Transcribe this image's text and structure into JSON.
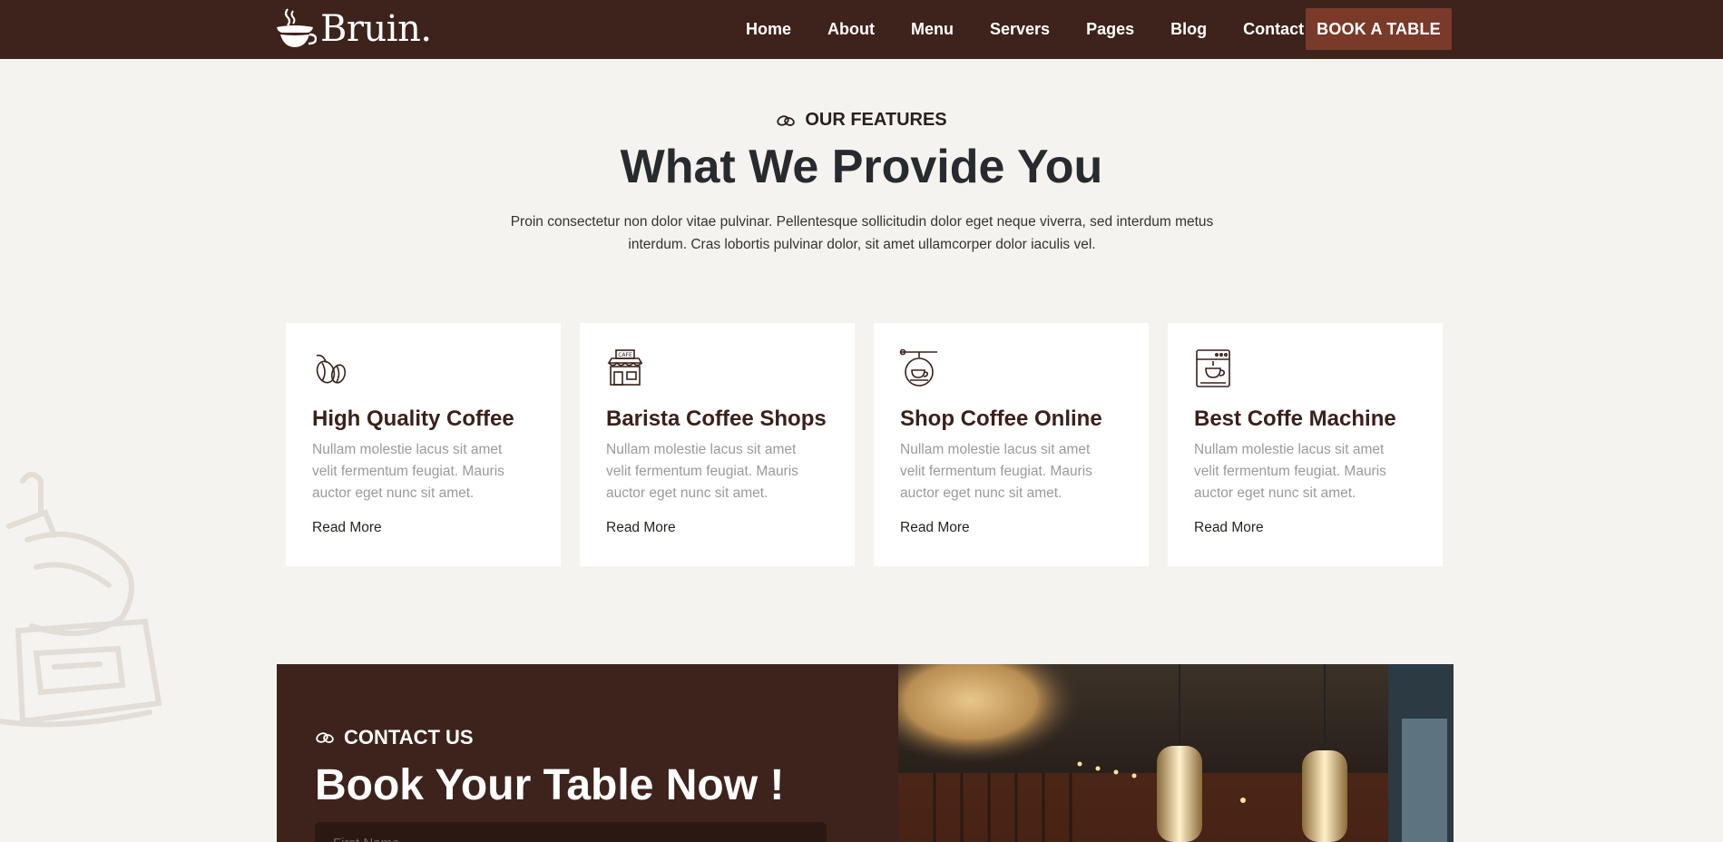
{
  "header": {
    "logo_text": "Bruin.",
    "nav": [
      "Home",
      "About",
      "Menu",
      "Servers",
      "Pages",
      "Blog",
      "Contact"
    ],
    "cta_label": "BOOK A TABLE"
  },
  "features": {
    "eyebrow": "OUR FEATURES",
    "title": "What We Provide You",
    "description": "Proin consectetur non dolor vitae pulvinar. Pellentesque sollicitudin dolor eget neque viverra, sed interdum metus interdum. Cras lobortis pulvinar dolor, sit amet ullamcorper dolor iaculis vel.",
    "cards": [
      {
        "icon": "coffee-beans-icon",
        "title": "High Quality Coffee",
        "text": "Nullam molestie lacus sit amet velit fermentum feugiat. Mauris auctor eget nunc sit amet.",
        "link": "Read More"
      },
      {
        "icon": "cafe-shop-icon",
        "title": "Barista Coffee Shops",
        "text": "Nullam molestie lacus sit amet velit fermentum feugiat. Mauris auctor eget nunc sit amet.",
        "link": "Read More"
      },
      {
        "icon": "coffee-sign-icon",
        "title": "Shop Coffee Online",
        "text": "Nullam molestie lacus sit amet velit fermentum feugiat. Mauris auctor eget nunc sit amet.",
        "link": "Read More"
      },
      {
        "icon": "coffee-machine-icon",
        "title": "Best Coffe Machine",
        "text": "Nullam molestie lacus sit amet velit fermentum feugiat. Mauris auctor eget nunc sit amet.",
        "link": "Read More"
      }
    ]
  },
  "contact": {
    "eyebrow": "CONTACT US",
    "title": "Book Your Table Now !",
    "first_name_placeholder": "First Name"
  },
  "colors": {
    "header_bg": "#3d231c",
    "accent": "#7a3a2a",
    "page_bg": "#f5f3ef"
  }
}
